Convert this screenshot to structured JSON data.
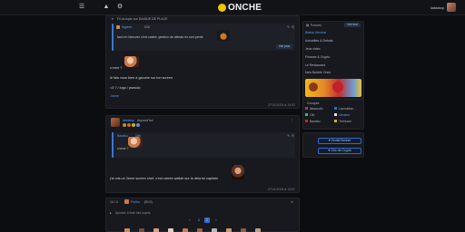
{
  "header": {
    "brand": "ONCHE",
    "username": "liatdatop"
  },
  "post1": {
    "pinned_label": "Fil du topic sur DAIGUE DE PLACE",
    "quote_author": "Ilqpeen",
    "quote_meta": "02h",
    "quote_text": "faut en t'assurer c'est castré, gestion de débuts en sort pente",
    "quote_btn": "Voir plus",
    "line1": "c'orne ?",
    "line2": "le fais vous bien à gauche sur ton screen",
    "line3": "<3 ? / logo / pseudo",
    "like_label": "J'aime",
    "footer_date": "27/11/2024 à 13:02"
  },
  "post2": {
    "author": "liatdatop",
    "meta": "Aujourd'hui",
    "quote_author": "Bazaku",
    "quote_meta": "10h",
    "quote_text": "c'orne ?",
    "body": "j'ai mis un 2eme screen chef, c'est carrée wallah sur la déla toi capitain",
    "footer_date": "27/11/2024 à 13:07"
  },
  "reply_bar": {
    "page_label": "14 / 4",
    "author": "Polrbo",
    "meta": "(ID:0)"
  },
  "reply_box": {
    "placeholder": "Ajoutez à liste des sujets"
  },
  "pagination": [
    "‹",
    "1",
    "2",
    "›"
  ],
  "sidebar": {
    "forums_label": "Forums",
    "forums_btn": "Voir tout",
    "links": [
      {
        "label": "Blabla Général",
        "active": true
      },
      {
        "label": "Actualités & Débats",
        "active": false
      },
      {
        "label": "Jeux vidéo",
        "active": false
      },
      {
        "label": "Finance & Crypto",
        "active": false
      },
      {
        "label": "Le Restaurant",
        "active": false
      },
      {
        "label": "New Bubble Onch",
        "active": false
      }
    ],
    "banner": "",
    "groups_label": "Groupes",
    "groups": [
      {
        "a": "liataoudic",
        "b": "Lavouillan..."
      },
      {
        "a": "Gib",
        "b": "Ulnaten"
      },
      {
        "a": "Bazaku",
        "b": "Tehreaot"
      }
    ],
    "create_btn": "Grofid Bonnie",
    "crypto_btn": "Grix de Crypto"
  },
  "colors": {
    "accent": "#3a76d6",
    "brand_yellow": "#f2c200",
    "bg": "#0c0d10",
    "card": "#17191e"
  }
}
